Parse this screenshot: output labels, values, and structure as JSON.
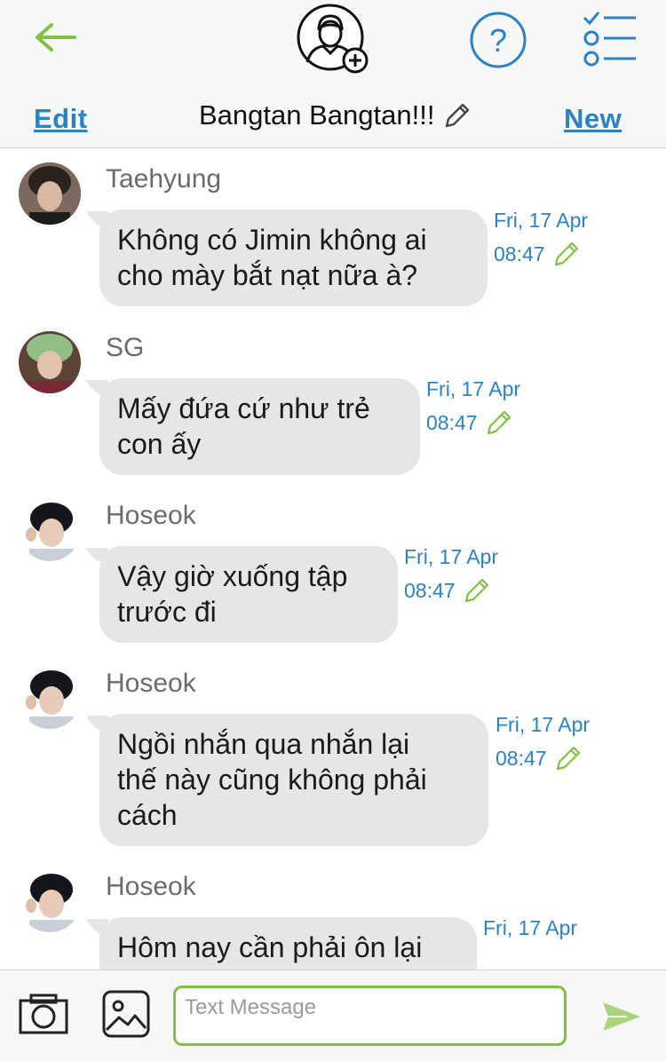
{
  "header": {
    "back_icon": "back-arrow-icon",
    "add_contact_icon": "person-add-icon",
    "help_icon": "question-circle-icon",
    "tasks_icon": "checklist-icon",
    "edit_label": "Edit",
    "title": "Bangtan Bangtan!!!",
    "title_edit_icon": "pencil-icon",
    "new_label": "New"
  },
  "messages": [
    {
      "sender": "Taehyung",
      "line1": "Không có Jimin không ai",
      "line2": "cho mày bắt nạt nữa à?",
      "date": "Fri, 17 Apr",
      "time": "08:47"
    },
    {
      "sender": "SG",
      "line1": "Mấy đứa cứ như trẻ",
      "line2": "con ấy",
      "date": "Fri, 17 Apr",
      "time": "08:47"
    },
    {
      "sender": "Hoseok",
      "line1": "Vậy giờ xuống tập",
      "line2": "trước đi",
      "date": "Fri, 17 Apr",
      "time": "08:47"
    },
    {
      "sender": "Hoseok",
      "line1": "Ngồi nhắn qua nhắn lại",
      "line2": "thế này cũng không phải",
      "line3": "cách",
      "date": "Fri, 17 Apr",
      "time": "08:47"
    },
    {
      "sender": "Hoseok",
      "line1": "Hôm nay cần phải ôn lại",
      "date": "Fri, 17 Apr"
    }
  ],
  "composer": {
    "camera_icon": "camera-icon",
    "gallery_icon": "image-icon",
    "placeholder": "Text Message",
    "value": "",
    "send_icon": "send-icon"
  },
  "colors": {
    "accent_blue": "#2a82c8",
    "accent_green": "#7fc241",
    "bubble": "#e6e6e6"
  }
}
